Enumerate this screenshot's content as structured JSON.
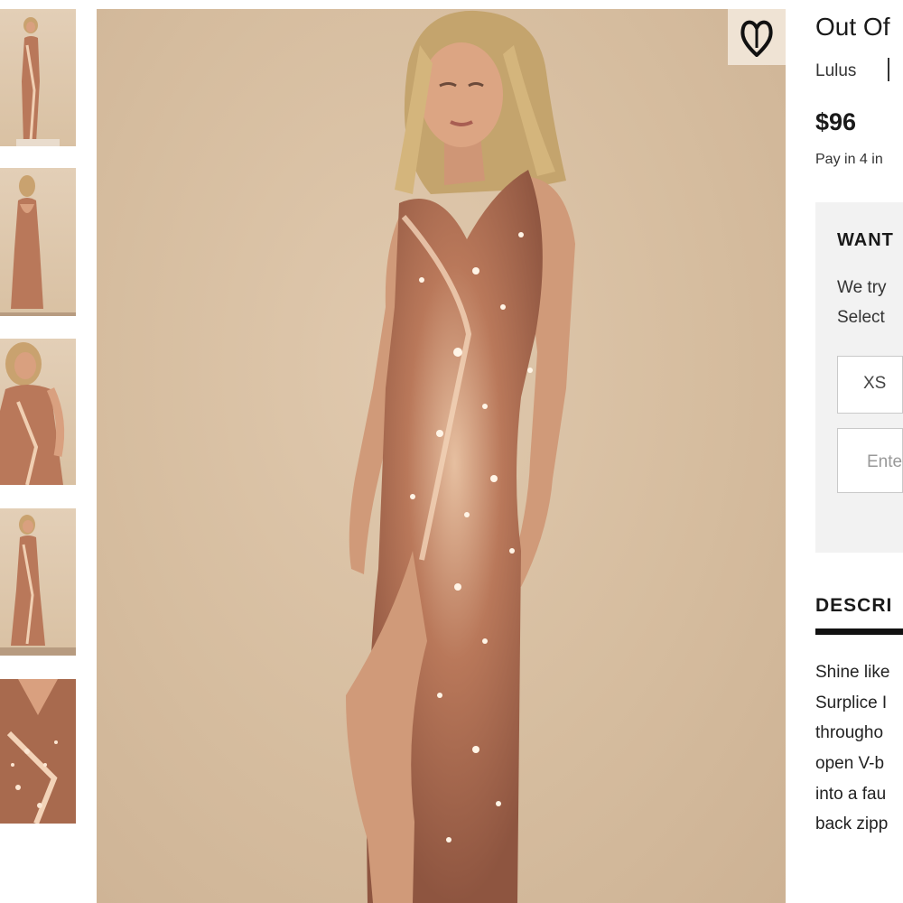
{
  "product": {
    "title": "Out Of",
    "brand": "Lulus",
    "price": "$96",
    "payment": "Pay in 4 in"
  },
  "fit": {
    "heading": "WANT",
    "line1": "We try",
    "line2": "Select",
    "size_option": "XS",
    "input_placeholder": "Ente"
  },
  "description": {
    "heading": "DESCRI",
    "lines": [
      "Shine like",
      "Surplice I",
      "througho",
      "open V-b",
      "into a fau",
      "back zipp"
    ]
  },
  "gallery": {
    "thumbnails": [
      "front-full-view",
      "back-full-view",
      "close-up-view",
      "walking-view",
      "detail-view"
    ],
    "favorite_icon": "heart-icon"
  },
  "colors": {
    "dress": "#b9785a",
    "sequin_highlight": "#f3d3b8",
    "skin": "#d9a07f",
    "hair": "#c4a46d",
    "backdrop": "#d8c0a2"
  }
}
